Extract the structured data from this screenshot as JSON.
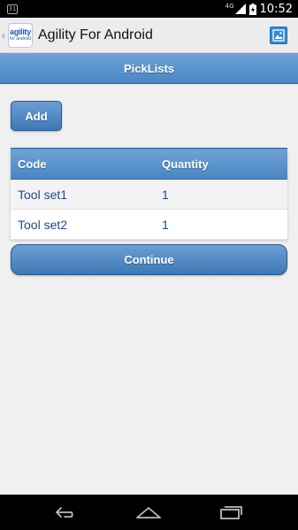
{
  "status_bar": {
    "notification": "31",
    "network": "4G",
    "time": "10:52"
  },
  "action_bar": {
    "logo_text_top": "agility",
    "logo_text_bottom": "for android",
    "title": "Agility For Android"
  },
  "page": {
    "title": "PickLists"
  },
  "add_button_label": "Add",
  "table": {
    "headers": [
      "Code",
      "Quantity"
    ],
    "rows": [
      {
        "code": "Tool set1",
        "quantity": "1"
      },
      {
        "code": "Tool set2",
        "quantity": "1"
      }
    ]
  },
  "continue_button_label": "Continue",
  "colors": {
    "header_blue": "#4a85c2",
    "link_text": "#1c4a85",
    "background": "#f0f0f0"
  },
  "icons": {
    "action_bar_right": "image-icon",
    "nav": [
      "back-icon",
      "home-icon",
      "recent-apps-icon"
    ]
  }
}
